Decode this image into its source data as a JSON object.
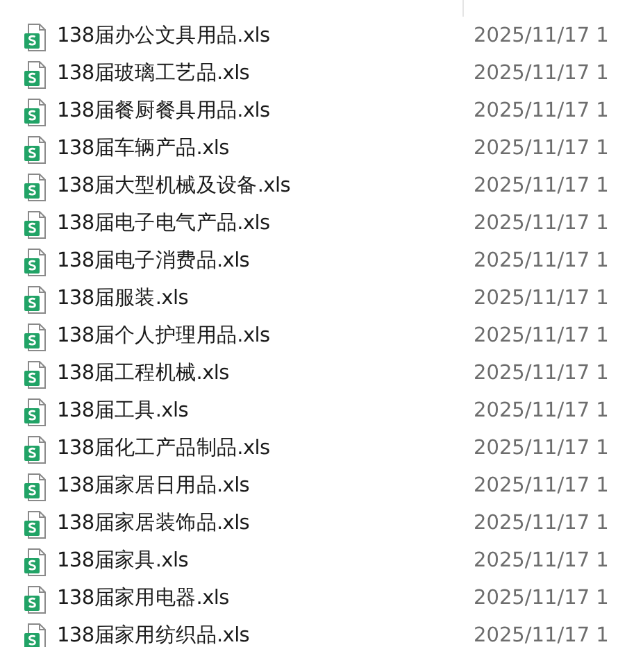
{
  "files": [
    {
      "name": "138届办公文具用品.xls",
      "modified": "2025/11/17 1"
    },
    {
      "name": "138届玻璃工艺品.xls",
      "modified": "2025/11/17 1"
    },
    {
      "name": "138届餐厨餐具用品.xls",
      "modified": "2025/11/17 1"
    },
    {
      "name": "138届车辆产品.xls",
      "modified": "2025/11/17 1"
    },
    {
      "name": "138届大型机械及设备.xls",
      "modified": "2025/11/17 1"
    },
    {
      "name": "138届电子电气产品.xls",
      "modified": "2025/11/17 1"
    },
    {
      "name": "138届电子消费品.xls",
      "modified": "2025/11/17 1"
    },
    {
      "name": "138届服装.xls",
      "modified": "2025/11/17 1"
    },
    {
      "name": "138届个人护理用品.xls",
      "modified": "2025/11/17 1"
    },
    {
      "name": "138届工程机械.xls",
      "modified": "2025/11/17 1"
    },
    {
      "name": "138届工具.xls",
      "modified": "2025/11/17 1"
    },
    {
      "name": "138届化工产品制品.xls",
      "modified": "2025/11/17 1"
    },
    {
      "name": "138届家居日用品.xls",
      "modified": "2025/11/17 1"
    },
    {
      "name": "138届家居装饰品.xls",
      "modified": "2025/11/17 1"
    },
    {
      "name": "138届家具.xls",
      "modified": "2025/11/17 1"
    },
    {
      "name": "138届家用电器.xls",
      "modified": "2025/11/17 1"
    },
    {
      "name": "138届家用纺织品.xls",
      "modified": "2025/11/17 1"
    }
  ]
}
